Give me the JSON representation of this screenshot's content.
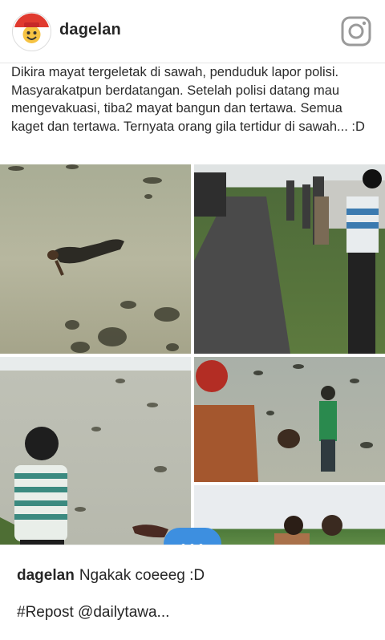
{
  "header": {
    "username": "dagelan",
    "instagram_icon": "instagram-camera-icon"
  },
  "post": {
    "image_caption": "Dikira mayat tergeletak di sawah, penduduk lapor polisi. Masyarakatpun berdatangan. Setelah polisi datang mau mengevakuasi, tiba2 mayat bangun dan tertawa. Semua kaget dan tertawa. Ternyata orang gila tertidur di sawah... :D",
    "repost": {
      "icon": "repost-icon",
      "username": "dailytawa"
    }
  },
  "caption": {
    "username": "dagelan",
    "text": "Ngakak coeeeg :D",
    "hashtag": "#Repost @dailytawa..."
  },
  "colors": {
    "accent": "#3d8fe0",
    "text": "#262626",
    "border": "#e6e6e6"
  }
}
